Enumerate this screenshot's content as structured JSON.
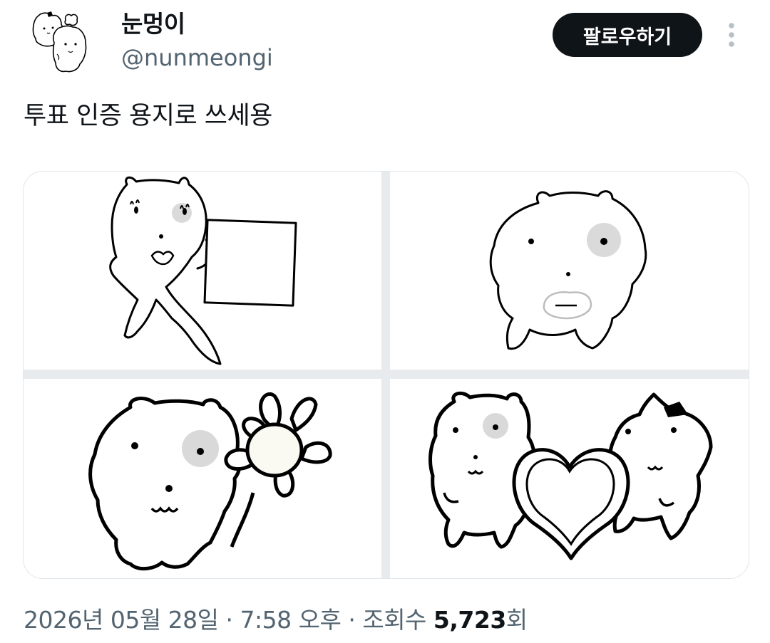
{
  "user": {
    "display_name": "눈멍이",
    "handle": "@nunmeongi"
  },
  "actions": {
    "follow_label": "팔로우하기",
    "more_icon": "more-vertical-icon"
  },
  "tweet": {
    "text": "투표 인증 용지로 쓰세용"
  },
  "media": {
    "images": [
      {
        "name": "character-holding-blank-sign-image"
      },
      {
        "name": "character-face-closeup-image"
      },
      {
        "name": "character-with-flower-image"
      },
      {
        "name": "two-characters-heart-image"
      }
    ]
  },
  "meta": {
    "date": "2026년 05월 28일",
    "separator1": " · ",
    "time": "7:58 오후",
    "separator2": " · ",
    "views_label": "조회수 ",
    "views_count": "5,723",
    "views_suffix": "회"
  },
  "colors": {
    "text_primary": "#0f1419",
    "text_secondary": "#536471",
    "button_bg": "#0f1419",
    "border": "#e1e6ea"
  }
}
